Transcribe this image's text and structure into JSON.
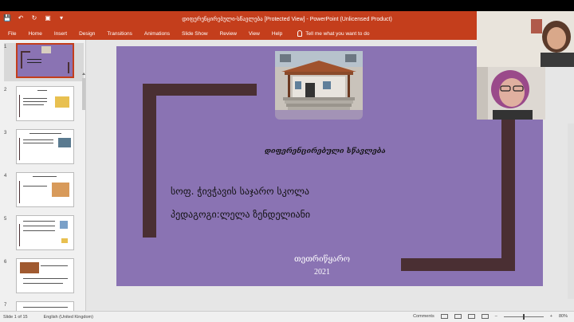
{
  "window": {
    "title": "დიფერენცირებული-სწავლება [Protected View] - PowerPoint (Unlicensed Product)",
    "qat_icons": [
      "save-icon",
      "undo-icon",
      "redo-icon",
      "slideshow-start-icon",
      "customize-icon"
    ]
  },
  "ribbon": {
    "tabs": [
      "File",
      "Home",
      "Insert",
      "Design",
      "Transitions",
      "Animations",
      "Slide Show",
      "Review",
      "View",
      "Help"
    ],
    "tell_me": "Tell me what you want to do"
  },
  "thumbnails": [
    {
      "number": "1",
      "active": true
    },
    {
      "number": "2",
      "active": false
    },
    {
      "number": "3",
      "active": false
    },
    {
      "number": "4",
      "active": false
    },
    {
      "number": "5",
      "active": false
    },
    {
      "number": "6",
      "active": false
    },
    {
      "number": "7",
      "active": false
    }
  ],
  "slide": {
    "subtitle": "დიფერენცირებული სწავლება",
    "school": "სოფ. ჭივჭავის საჯარო სკოლა",
    "teacher": "პედაგოგი:ლელა ზენდელიანი",
    "city": "თეთრიწყარო",
    "year": "2021",
    "background": "#8a73b3",
    "frame_color": "#4a2f33"
  },
  "status": {
    "slide_info": "Slide 1 of 15",
    "language": "English (United Kingdom)",
    "comments": "Comments",
    "zoom": "80%"
  }
}
